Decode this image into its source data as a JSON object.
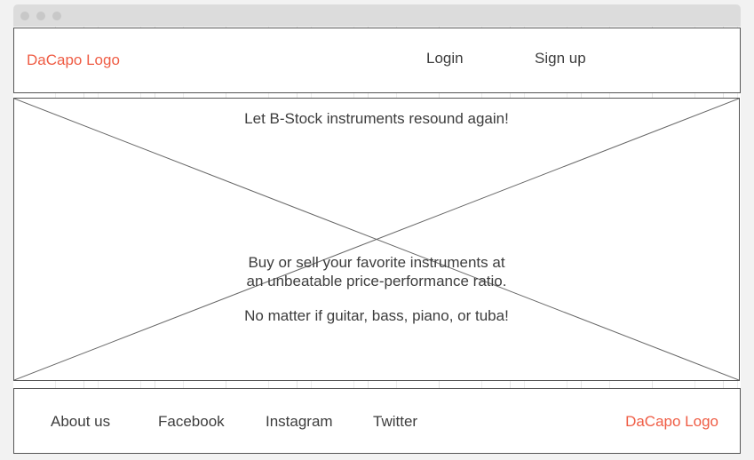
{
  "header": {
    "logo": "DaCapo Logo",
    "nav": {
      "login": "Login",
      "signup": "Sign up"
    }
  },
  "hero": {
    "title": "Let B-Stock instruments resound again!",
    "line1": "Buy or sell your favorite instruments at",
    "line2": "an unbeatable price-performance ratio.",
    "line3": "No matter if guitar, bass, piano, or tuba!"
  },
  "footer": {
    "links": {
      "about": "About us",
      "facebook": "Facebook",
      "instagram": "Instagram",
      "twitter": "Twitter"
    },
    "logo": "DaCapo Logo"
  },
  "colors": {
    "accent": "#ef5d45",
    "text": "#3d3d3d",
    "border": "#555555",
    "background": "#f2f2f2"
  }
}
